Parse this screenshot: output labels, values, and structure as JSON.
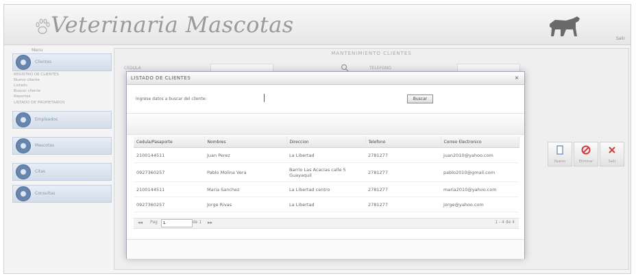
{
  "app": {
    "title": "Veterinaria Mascotas",
    "user_link": "Salir"
  },
  "sidebar": {
    "caption": "Menu",
    "items": [
      {
        "label": "Clientes",
        "icon": "user-icon"
      },
      {
        "label": "Empleados",
        "icon": "user-icon"
      },
      {
        "label": "Mascotas",
        "icon": "pet-icon"
      },
      {
        "label": "Citas",
        "icon": "calendar-icon"
      },
      {
        "label": "Consultas",
        "icon": "clipboard-icon"
      }
    ],
    "subitems": [
      "REGISTRO DE CLIENTES",
      "Nuevo cliente",
      "Listado",
      "Buscar cliente",
      "Reportes",
      "LISTADO DE PROPIETARIOS"
    ]
  },
  "main": {
    "title": "MANTENIMIENTO CLIENTES",
    "fields": {
      "cedula_label": "CEDULA",
      "telefono_label": "TELEFONO"
    },
    "actions": [
      {
        "label": "Nuevo",
        "icon": "new-icon",
        "color": "#3a6ea5"
      },
      {
        "label": "Eliminar",
        "icon": "delete-icon",
        "color": "#d23b3b"
      },
      {
        "label": "Salir",
        "icon": "exit-icon",
        "color": "#d23b3b"
      }
    ]
  },
  "dialog": {
    "title": "LISTADO DE CLIENTES",
    "search_label": "Ingrese datos a buscar del cliente:",
    "search_value": "",
    "search_button": "Buscar",
    "columns": [
      "Cedula/Pasaporte",
      "Nombres",
      "Direccion",
      "Telefono",
      "Correo Electronico"
    ],
    "rows": [
      [
        "2100144511",
        "Juan Perez",
        "La Libertad",
        "2781277",
        "juan2010@yahoo.com"
      ],
      [
        "0927360257",
        "Pablo Molina Vera",
        "Barrio Las Acacias calle 5 Guayaquil",
        "2781277",
        "pablo2010@gmail.com"
      ],
      [
        "2100144511",
        "Maria Sanchez",
        "La Libertad centro",
        "2781277",
        "maria2010@yahoo.com"
      ],
      [
        "0927360257",
        "Jorge Rivas",
        "La Libertad",
        "2781277",
        "jorge@yahoo.com"
      ]
    ],
    "pager": {
      "page_label": "Pag",
      "page_value": "1",
      "total": "de 1",
      "summary": "1 - 4 de 4"
    }
  }
}
